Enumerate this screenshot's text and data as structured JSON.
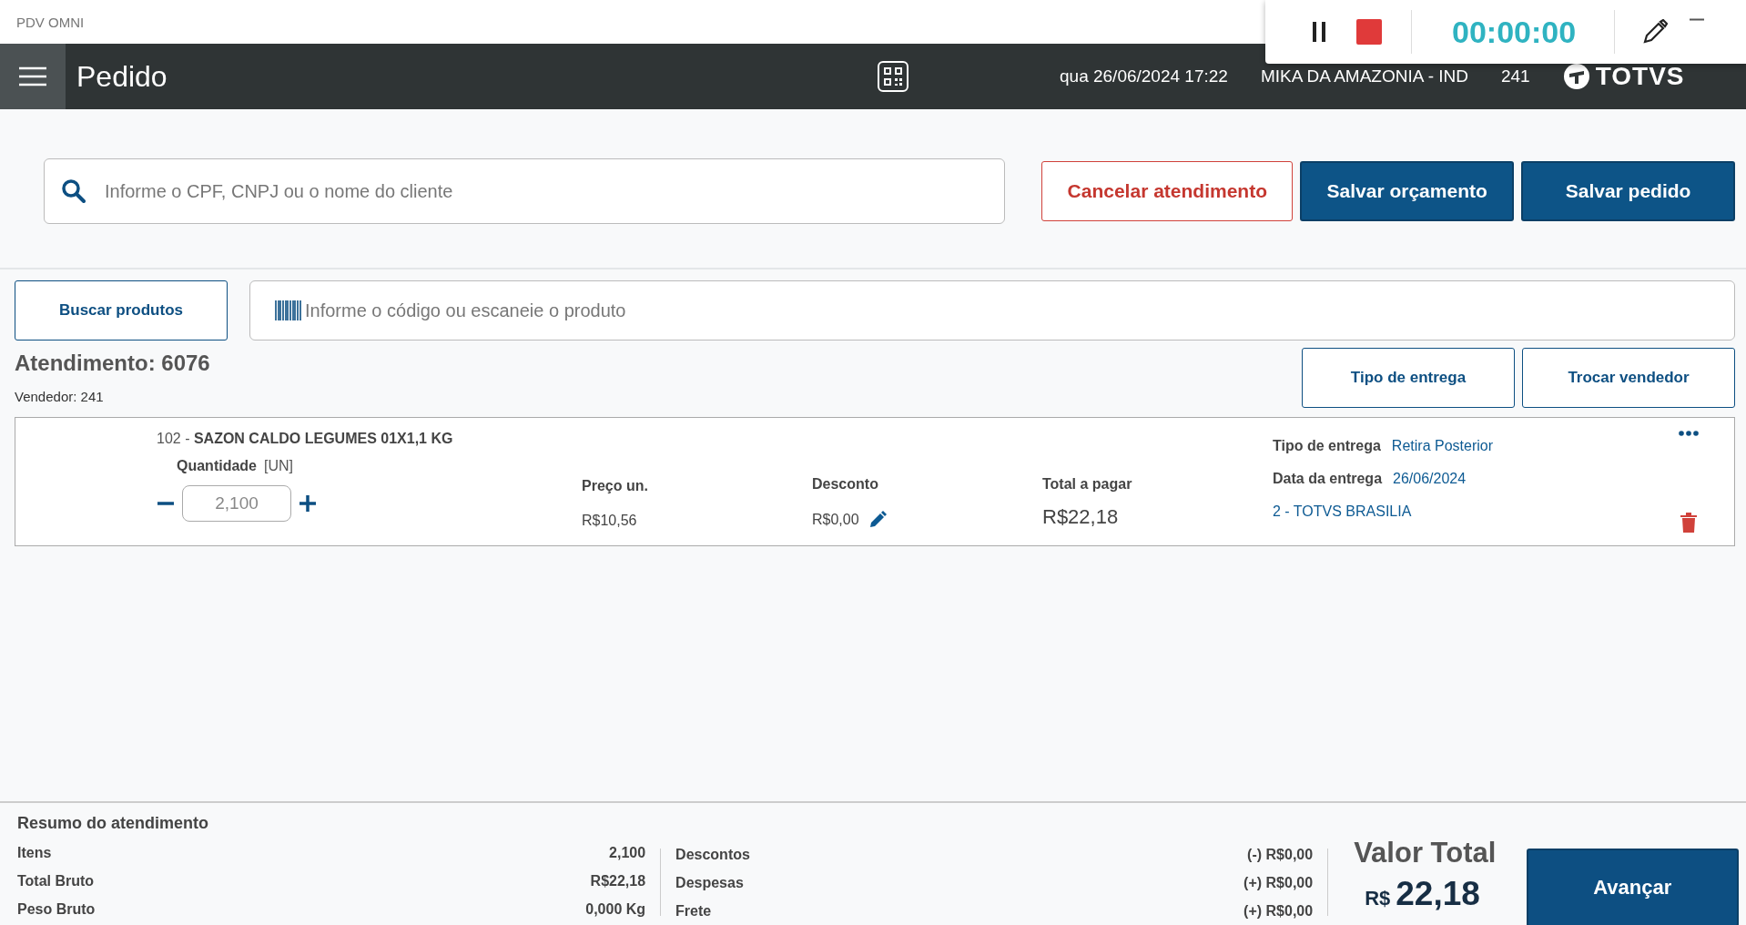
{
  "app_title": "PDV OMNI",
  "header": {
    "title": "Pedido",
    "datetime": "qua 26/06/2024 17:22",
    "store": "MIKA DA AMAZONIA - IND",
    "terminal": "241",
    "brand": "TOTVS"
  },
  "recorder": {
    "timer": "00:00:00"
  },
  "customer_search": {
    "placeholder": "Informe o CPF, CNPJ ou o nome do cliente"
  },
  "actions": [
    {
      "label": "Cancelar atendimento",
      "kind": "danger"
    },
    {
      "label": "Salvar orçamento",
      "kind": "primary"
    },
    {
      "label": "Salvar pedido",
      "kind": "primary"
    }
  ],
  "product_search": {
    "button": "Buscar produtos",
    "placeholder": "Informe o código ou escaneie o produto"
  },
  "attendance": {
    "title": "Atendimento: 6076",
    "seller": "Vendedor: 241"
  },
  "attendance_actions": [
    "Tipo de entrega",
    "Trocar vendedor"
  ],
  "items": [
    {
      "code": "102 - ",
      "name": "SAZON CALDO LEGUMES 01X1,1 KG",
      "qty_label": "Quantidade",
      "unit": "[UN]",
      "quantity": "2,100",
      "price_label": "Preço un.",
      "price": "R$10,56",
      "discount_label": "Desconto",
      "discount": "R$0,00",
      "total_label": "Total a pagar",
      "total": "R$22,18",
      "delivery_type_label": "Tipo de entrega",
      "delivery_type": "Retira Posterior",
      "delivery_date_label": "Data da entrega",
      "delivery_date": "26/06/2024",
      "branch": "2 - TOTVS BRASILIA"
    }
  ],
  "summary": {
    "title": "Resumo do atendimento",
    "left": [
      {
        "label": "Itens",
        "value": "2,100"
      },
      {
        "label": "Total Bruto",
        "value": "R$22,18"
      },
      {
        "label": "Peso Bruto",
        "value": "0,000 Kg"
      }
    ],
    "right": [
      {
        "label": "Descontos",
        "value": "(-) R$0,00"
      },
      {
        "label": "Despesas",
        "value": "(+) R$0,00"
      },
      {
        "label": "Frete",
        "value": "(+) R$0,00"
      }
    ],
    "total_label": "Valor Total",
    "currency": "R$",
    "total": "22,18",
    "next": "Avançar"
  }
}
